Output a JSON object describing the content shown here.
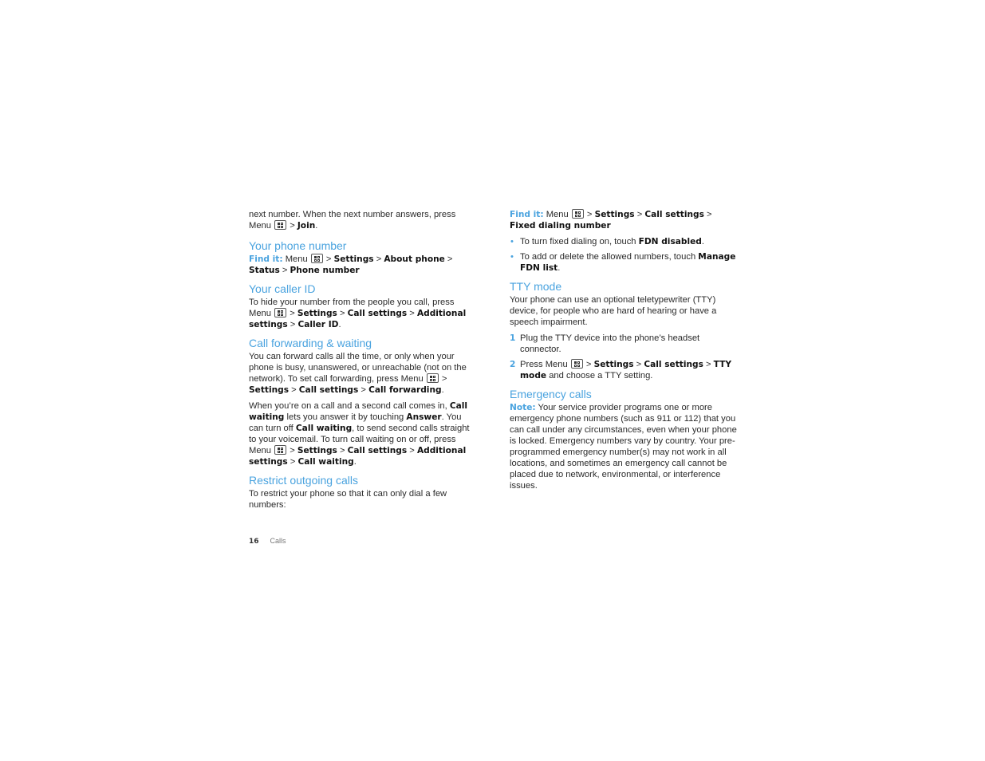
{
  "page": {
    "number": "16",
    "section": "Calls"
  },
  "icons": {
    "menu": "menu-key-icon"
  },
  "colors": {
    "heading": "#4aa3df",
    "body_text": "#2a2a2a",
    "bold_text": "#111111"
  },
  "left": {
    "intro": {
      "t1": "next number. When the next number answers, press Menu",
      "t2": " > ",
      "b1": "Join",
      "t3": "."
    },
    "phone_number": {
      "heading": "Your phone number",
      "find_label": "Find it:",
      "t1": " Menu",
      "sep": " > ",
      "b1": "Settings",
      "b2": "About phone",
      "b3": "Status",
      "b4": "Phone number"
    },
    "caller_id": {
      "heading": "Your caller ID",
      "t1": "To hide your number from the people you call, press Menu",
      "sep": " > ",
      "b1": "Settings",
      "b2": "Call settings",
      "b3": "Additional settings",
      "b4": "Caller ID",
      "end": "."
    },
    "forwarding": {
      "heading": "Call forwarding & waiting",
      "p1_t1": "You can forward calls all the time, or only when your phone is busy, unanswered, or unreachable (not on the network). To set call forwarding, press Menu",
      "sep": " > ",
      "p1_b1": "Settings",
      "p1_b2": "Call settings",
      "p1_b3": "Call forwarding",
      "end": ".",
      "p2_t1": "When you’re on a call and a second call comes in, ",
      "p2_b1": "Call waiting",
      "p2_t2": " lets you answer it by touching ",
      "p2_b2": "Answer",
      "p2_t3": ". You can turn off ",
      "p2_b3": "Call waiting",
      "p2_t4": ", to send second calls straight to your voicemail. To turn call waiting on or off, press Menu",
      "p2_b4": "Settings",
      "p2_b5": "Call settings",
      "p2_b6": "Additional settings",
      "p2_b7": "Call waiting"
    },
    "restrict": {
      "heading": "Restrict outgoing calls",
      "t1": "To restrict your phone so that it can only dial a few numbers:"
    }
  },
  "right": {
    "fdn": {
      "find_label": "Find it:",
      "t1": " Menu",
      "sep": " > ",
      "b1": "Settings",
      "b2": "Call settings",
      "b3": "Fixed dialing number",
      "bullets": [
        {
          "marker": "•",
          "t1": "To turn fixed dialing on, touch ",
          "b1": "FDN disabled",
          "t2": "."
        },
        {
          "marker": "•",
          "t1": "To add or delete the allowed numbers, touch ",
          "b1": "Manage FDN list",
          "t2": "."
        }
      ]
    },
    "tty": {
      "heading": "TTY mode",
      "intro": "Your phone can use an optional teletypewriter (TTY) device, for people who are hard of hearing or have a speech impairment.",
      "steps": [
        {
          "num": "1",
          "text": "Plug the TTY device into the phone’s headset connector."
        },
        {
          "num": "2",
          "t1": "Press Menu",
          "sep": " > ",
          "b1": "Settings",
          "b2": "Call settings",
          "b3": "TTY mode",
          "t2": " and choose a TTY setting."
        }
      ]
    },
    "emergency": {
      "heading": "Emergency calls",
      "note_label": "Note:",
      "text": " Your service provider programs one or more emergency phone numbers (such as 911 or 112) that you can call under any circumstances, even when your phone is locked. Emergency numbers vary by country. Your pre-programmed emergency number(s) may not work in all locations, and sometimes an emergency call cannot be placed due to network, environmental, or interference issues."
    }
  }
}
